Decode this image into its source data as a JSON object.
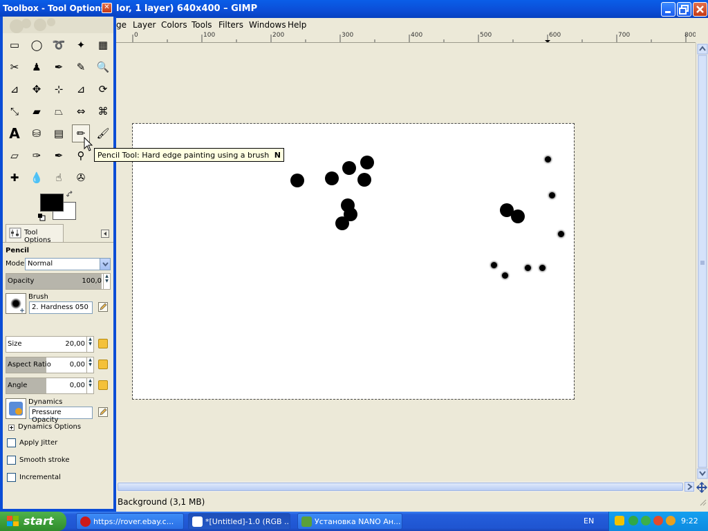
{
  "window": {
    "title": "lor, 1 layer) 640x400 – GIMP",
    "menu": [
      "ge",
      "Layer",
      "Colors",
      "Tools",
      "Filters",
      "Windows",
      "Help"
    ],
    "ruler_labels": [
      "0",
      "100",
      "200",
      "300",
      "400",
      "500",
      "600",
      "700",
      "800"
    ],
    "status": "Background (3,1 MB)"
  },
  "toolbox": {
    "title": "Toolbox - Tool Options",
    "tooltip": "Pencil Tool: Hard edge painting using a brush",
    "tooltip_key": "N",
    "tools": [
      {
        "name": "rect-select-icon",
        "glyph": "▭"
      },
      {
        "name": "ellipse-select-icon",
        "glyph": "◯"
      },
      {
        "name": "free-select-icon",
        "glyph": "➰"
      },
      {
        "name": "fuzzy-select-icon",
        "glyph": "✦"
      },
      {
        "name": "select-by-color-icon",
        "glyph": "▦"
      },
      {
        "name": "scissors-select-icon",
        "glyph": "✂"
      },
      {
        "name": "foreground-select-icon",
        "glyph": "♟"
      },
      {
        "name": "paths-icon",
        "glyph": "✒"
      },
      {
        "name": "color-picker-icon",
        "glyph": "✎"
      },
      {
        "name": "zoom-icon",
        "glyph": "🔍"
      },
      {
        "name": "measure-icon",
        "glyph": "⊿"
      },
      {
        "name": "move-icon",
        "glyph": "✥"
      },
      {
        "name": "align-icon",
        "glyph": "⊹"
      },
      {
        "name": "crop-icon",
        "glyph": "⊿"
      },
      {
        "name": "rotate-icon",
        "glyph": "⟳"
      },
      {
        "name": "scale-icon",
        "glyph": "⤡"
      },
      {
        "name": "shear-icon",
        "glyph": "▰"
      },
      {
        "name": "perspective-icon",
        "glyph": "⏢"
      },
      {
        "name": "flip-icon",
        "glyph": "⇔"
      },
      {
        "name": "cage-icon",
        "glyph": "⌘"
      },
      {
        "name": "text-icon",
        "glyph": "A"
      },
      {
        "name": "bucket-fill-icon",
        "glyph": "⛁"
      },
      {
        "name": "blend-icon",
        "glyph": "▤"
      },
      {
        "name": "pencil-icon",
        "glyph": "✏"
      },
      {
        "name": "paintbrush-icon",
        "glyph": "🖌"
      },
      {
        "name": "eraser-icon",
        "glyph": "▱"
      },
      {
        "name": "airbrush-icon",
        "glyph": "✑"
      },
      {
        "name": "ink-icon",
        "glyph": "✒"
      },
      {
        "name": "clone-icon",
        "glyph": "⚲"
      },
      {
        "name": "empty-slot-icon",
        "glyph": ""
      },
      {
        "name": "heal-icon",
        "glyph": "✚"
      },
      {
        "name": "blur-icon",
        "glyph": "💧"
      },
      {
        "name": "smudge-icon",
        "glyph": "☝"
      },
      {
        "name": "dodge-burn-icon",
        "glyph": "✇"
      },
      {
        "name": "empty-slot-2-icon",
        "glyph": ""
      }
    ],
    "colors": {
      "foreground": "#000000",
      "background": "#ffffff"
    }
  },
  "tool_options": {
    "tab_label": "Tool Options",
    "tool_name": "Pencil",
    "mode_label": "Mode:",
    "mode_value": "Normal",
    "opacity_label": "Opacity",
    "opacity_value": "100,0",
    "opacity_fraction": 1.0,
    "brush_label": "Brush",
    "brush_value": "2. Hardness 050",
    "size_label": "Size",
    "size_value": "20,00",
    "aspect_label": "Aspect Ratio",
    "aspect_value": "0,00",
    "angle_label": "Angle",
    "angle_value": "0,00",
    "dynamics_label": "Dynamics",
    "dynamics_value": "Pressure Opacity",
    "dynamics_options": "Dynamics Options",
    "apply_jitter": "Apply Jitter",
    "smooth_stroke": "Smooth stroke",
    "incremental": "Incremental"
  },
  "taskbar": {
    "start": "start",
    "tasks": [
      "https://rover.ebay.c...",
      "*[Untitled]-1.0 (RGB ...",
      "Установка NANO Ан..."
    ],
    "lang": "EN",
    "clock": "9:22"
  }
}
